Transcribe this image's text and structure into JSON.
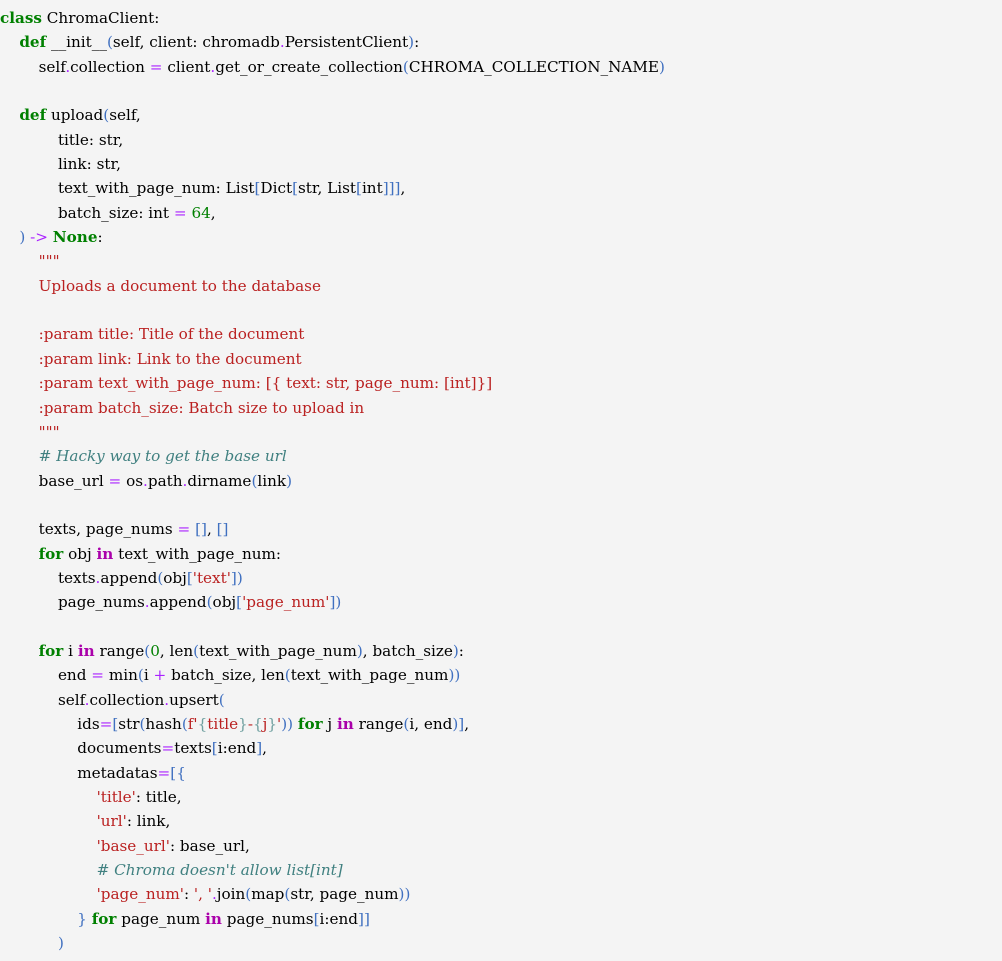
{
  "view": {
    "kind": "source-code-listing",
    "language": "Python",
    "background_color": "#f4f4f4",
    "default_text_color": "#000000"
  },
  "theme": {
    "keyword": "#008000",
    "keyword_operator": "#aa00aa",
    "builtin_constant": "#008000",
    "name": "#000000",
    "bracket": "#4070c0",
    "operator": "#aa22ff",
    "number": "#008000",
    "string": "#ba2121",
    "docstring": "#ba2121",
    "comment": "#408080",
    "fstring_brace": "#70a0a0"
  },
  "code": {
    "title": "class ChromaClient",
    "lines": [
      "class ChromaClient:",
      "    def __init__(self, client: chromadb.PersistentClient):",
      "        self.collection = client.get_or_create_collection(CHROMA_COLLECTION_NAME)",
      "",
      "    def upload(self,",
      "               title: str,",
      "               link: str,",
      "               text_with_page_num: List[Dict[str, List[int]]],",
      "               batch_size: int = 64,",
      "    ) -> None:",
      "        \"\"\"",
      "        Uploads a document to the database",
      "",
      "        :param title: Title of the document",
      "        :param link: Link to the document",
      "        :param text_with_page_num: [{ text: str, page_num: [int]}]",
      "        :param batch_size: Batch size to upload in",
      "        \"\"\"",
      "        # Hacky way to get the base url",
      "        base_url = os.path.dirname(link)",
      "",
      "        texts, page_nums = [], []",
      "        for obj in text_with_page_num:",
      "            texts.append(obj['text'])",
      "            page_nums.append(obj['page_num'])",
      "",
      "        for i in range(0, len(text_with_page_num), batch_size):",
      "            end = min(i + batch_size, len(text_with_page_num))",
      "            self.collection.upsert(",
      "                ids=[str(hash(f'{title}-{j}')) for j in range(i, end)],",
      "                documents=texts[i:end],",
      "                metadatas=[{",
      "                    'title': title,",
      "                    'url': link,",
      "                    'base_url': base_url,",
      "                    # Chroma doesn't allow list[int]",
      "                    'page_num': ', '.join(map(str, page_num))",
      "                } for page_num in page_nums[i:end]]",
      "            )"
    ],
    "identifiers": {
      "class_name": "ChromaClient",
      "methods": [
        "__init__",
        "upload"
      ],
      "parameters": [
        "self",
        "client",
        "title",
        "link",
        "text_with_page_num",
        "batch_size"
      ],
      "constants": [
        "CHROMA_COLLECTION_NAME"
      ],
      "default_values": {
        "batch_size": "64"
      },
      "return_annotation": "None"
    },
    "docstring": {
      "summary": "Uploads a document to the database",
      "params": [
        {
          "name": "title",
          "desc": "Title of the document"
        },
        {
          "name": "link",
          "desc": "Link to the document"
        },
        {
          "name": "text_with_page_num",
          "desc": "[{ text: str, page_num: [int]}]"
        },
        {
          "name": "batch_size",
          "desc": "Batch size to upload in"
        }
      ]
    },
    "comments": [
      "# Hacky way to get the base url",
      "# Chroma doesn't allow list[int]"
    ],
    "string_literals": [
      "'text'",
      "'page_num'",
      "'title'",
      "'url'",
      "'base_url'",
      "', '"
    ],
    "fstring": "f'{title}-{j}'"
  }
}
